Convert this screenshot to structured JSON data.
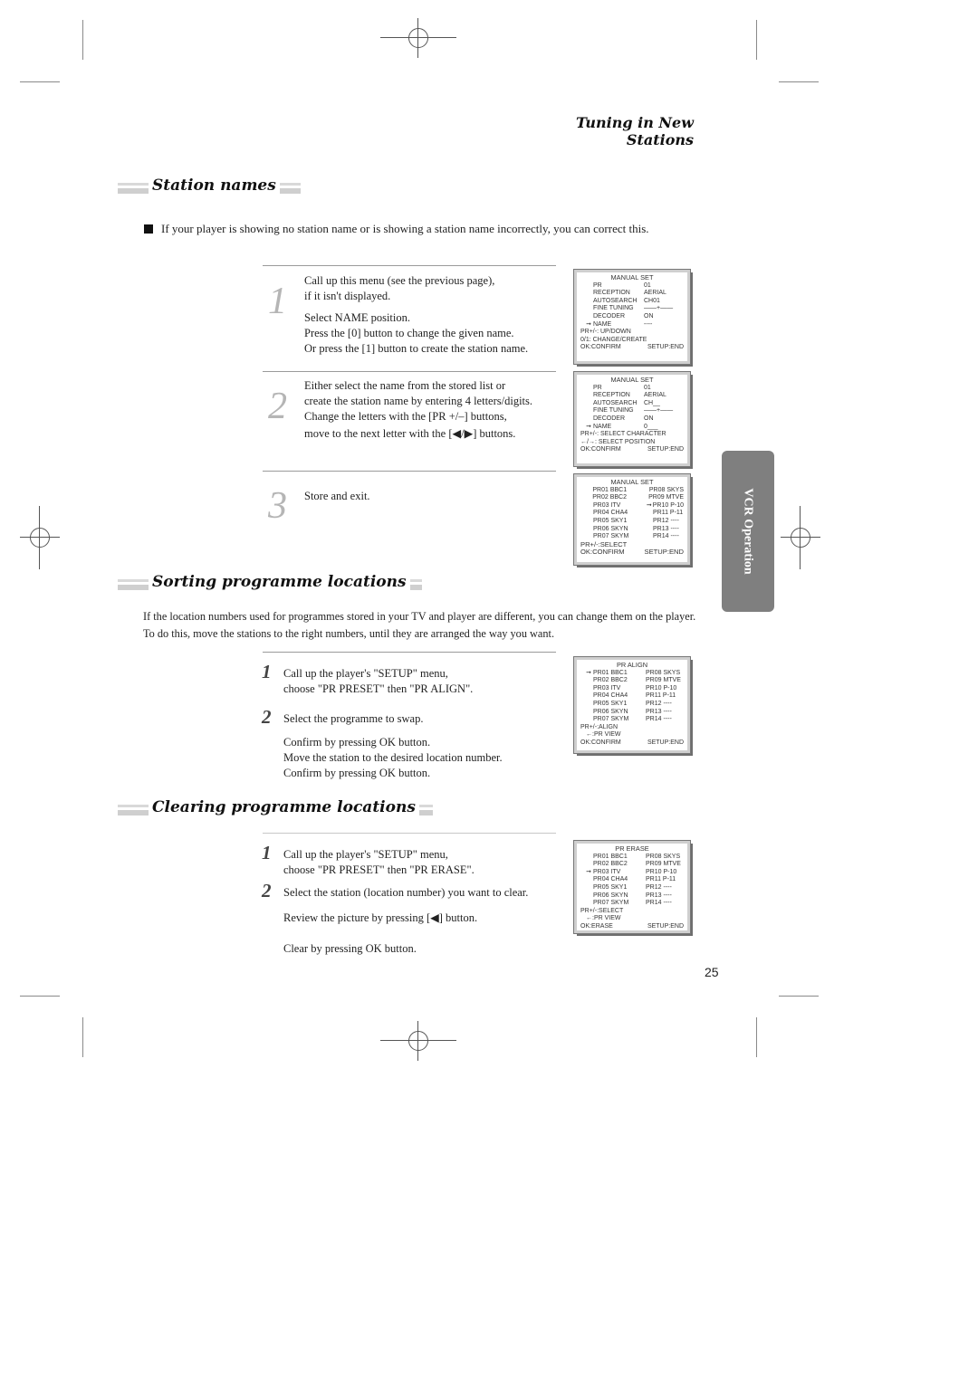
{
  "header": {
    "title": "Tuning in New Stations"
  },
  "side_tab": {
    "label": "VCR Operation",
    "color": "#7f7f7f"
  },
  "page_number": "25",
  "station_names": {
    "heading": "Station names",
    "intro": "If your player is showing no station name or is showing a station name incorrectly, you can correct this.",
    "steps": [
      {
        "num": "1",
        "lines": [
          "Call up this menu (see the previous page),",
          "if it isn't displayed."
        ],
        "lines2": [
          "Select NAME position.",
          "Press the [0] button to change the given name.",
          "Or press the [1] button to create the station name."
        ]
      },
      {
        "num": "2",
        "lines": [
          "Either select the name from the stored list or",
          "create the station name by entering 4 letters/digits.",
          "Change the letters with the [PR +/–] buttons,",
          "move to the next letter with the [◀/▶] buttons."
        ]
      },
      {
        "num": "3",
        "lines": [
          "Store and exit."
        ]
      }
    ],
    "screens": [
      {
        "title": "MANUAL SET",
        "rows": [
          {
            "arrow": "",
            "key": "PR",
            "value": "01"
          },
          {
            "arrow": "",
            "key": "RECEPTION",
            "value": "AERIAL"
          },
          {
            "arrow": "",
            "key": "AUTOSEARCH",
            "value": "CH01"
          },
          {
            "arrow": "",
            "key": "FINE TUNING",
            "value": "——+——"
          },
          {
            "arrow": "",
            "key": "DECODER",
            "value": "ON"
          },
          {
            "arrow": "➞",
            "key": "NAME",
            "value": "----"
          }
        ],
        "help": [
          "PR+/-: UP/DOWN",
          "0/1: CHANGE/CREATE"
        ],
        "footer_left": "OK:CONFIRM",
        "footer_right": "SETUP:END"
      },
      {
        "title": "MANUAL SET",
        "rows": [
          {
            "arrow": "",
            "key": "PR",
            "value": "01"
          },
          {
            "arrow": "",
            "key": "RECEPTION",
            "value": "AERIAL"
          },
          {
            "arrow": "",
            "key": "AUTOSEARCH",
            "value": "CH__"
          },
          {
            "arrow": "",
            "key": "FINE TUNING",
            "value": "——+——"
          },
          {
            "arrow": "",
            "key": "DECODER",
            "value": "ON"
          },
          {
            "arrow": "➞",
            "key": "NAME",
            "value": "0___"
          }
        ],
        "help": [
          "PR+/-: SELECT CHARACTER",
          "←/→: SELECT POSITION"
        ],
        "footer_left": "OK:CONFIRM",
        "footer_right": "SETUP:END"
      },
      {
        "title": "MANUAL SET",
        "list": [
          {
            "left_arrow": "",
            "left": "PR01 BBC1",
            "mid_arrow": "",
            "right": "PR08 SKYS"
          },
          {
            "left_arrow": "",
            "left": "PR02 BBC2",
            "mid_arrow": "",
            "right": "PR09 MTVE"
          },
          {
            "left_arrow": "",
            "left": "PR03 ITV",
            "mid_arrow": "➞",
            "right": "PR10 P-10"
          },
          {
            "left_arrow": "",
            "left": "PR04 CHA4",
            "mid_arrow": "",
            "right": "PR11 P-11"
          },
          {
            "left_arrow": "",
            "left": "PR05 SKY1",
            "mid_arrow": "",
            "right": "PR12 ----"
          },
          {
            "left_arrow": "",
            "left": "PR06 SKYN",
            "mid_arrow": "",
            "right": "PR13 ----"
          },
          {
            "left_arrow": "",
            "left": "PR07 SKYM",
            "mid_arrow": "",
            "right": "PR14 ----"
          }
        ],
        "help": [
          "PR+/-:SELECT"
        ],
        "footer_left": "OK:CONFIRM",
        "footer_right": "SETUP:END"
      }
    ]
  },
  "sorting": {
    "heading": "Sorting programme locations",
    "intro": "If the location numbers used for programmes stored in your TV and player are different, you can change them on the player. To do this, move the stations to the right numbers, until they are arranged the way you want.",
    "steps": [
      {
        "num": "1",
        "lines": [
          "Call up the player's \"SETUP\" menu,",
          "choose \"PR PRESET\" then \"PR ALIGN\"."
        ]
      },
      {
        "num": "2",
        "lines": [
          "Select the programme to swap."
        ],
        "lines2": [
          "Confirm by pressing OK button.",
          "Move the station to the desired location number.",
          "Confirm by pressing OK button."
        ]
      }
    ],
    "screen": {
      "title": "PR ALIGN",
      "list": [
        {
          "left_arrow": "➞",
          "left": "PR01 BBC1",
          "right": "PR08 SKYS"
        },
        {
          "left_arrow": "",
          "left": "PR02 BBC2",
          "right": "PR09 MTVE"
        },
        {
          "left_arrow": "",
          "left": "PR03 ITV",
          "right": "PR10 P-10"
        },
        {
          "left_arrow": "",
          "left": "PR04 CHA4",
          "right": "PR11 P-11"
        },
        {
          "left_arrow": "",
          "left": "PR05 SKY1",
          "right": "PR12 ----"
        },
        {
          "left_arrow": "",
          "left": "PR06 SKYN",
          "right": "PR13 ----"
        },
        {
          "left_arrow": "",
          "left": "PR07 SKYM",
          "right": "PR14 ----"
        }
      ],
      "help": [
        "PR+/-:ALIGN",
        "←:PR VIEW"
      ],
      "footer_left": "OK:CONFIRM",
      "footer_right": "SETUP:END"
    }
  },
  "clearing": {
    "heading": "Clearing programme locations",
    "steps": [
      {
        "num": "1",
        "lines": [
          "Call up the player's \"SETUP\" menu,",
          "choose \"PR PRESET\" then \"PR ERASE\"."
        ]
      },
      {
        "num": "2",
        "lines": [
          "Select the station (location number) you want to clear."
        ],
        "lines2": [
          "Review the picture by pressing [◀] button."
        ],
        "lines3": [
          "Clear by pressing OK button."
        ]
      }
    ],
    "screen": {
      "title": "PR ERASE",
      "list": [
        {
          "left_arrow": "",
          "left": "PR01 BBC1",
          "right": "PR08 SKYS"
        },
        {
          "left_arrow": "",
          "left": "PR02 BBC2",
          "right": "PR09 MTVE"
        },
        {
          "left_arrow": "➞",
          "left": "PR03 ITV",
          "right": "PR10 P-10"
        },
        {
          "left_arrow": "",
          "left": "PR04 CHA4",
          "right": "PR11 P-11"
        },
        {
          "left_arrow": "",
          "left": "PR05 SKY1",
          "right": "PR12 ----"
        },
        {
          "left_arrow": "",
          "left": "PR06 SKYN",
          "right": "PR13 ----"
        },
        {
          "left_arrow": "",
          "left": "PR07 SKYM",
          "right": "PR14 ----"
        }
      ],
      "help": [
        "PR+/-:SELECT",
        "←:PR VIEW"
      ],
      "footer_left": "OK:ERASE",
      "footer_right": "SETUP:END"
    }
  }
}
